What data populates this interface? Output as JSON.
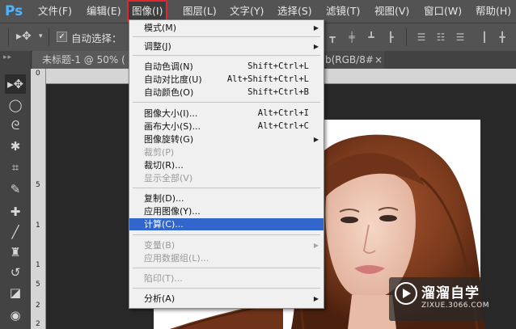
{
  "app": {
    "logo": "Ps"
  },
  "menubar": {
    "items": [
      {
        "label": "文件(F)"
      },
      {
        "label": "编辑(E)"
      },
      {
        "label": "图像(I)"
      },
      {
        "label": "图层(L)"
      },
      {
        "label": "文字(Y)"
      },
      {
        "label": "选择(S)"
      },
      {
        "label": "滤镜(T)"
      },
      {
        "label": "视图(V)"
      },
      {
        "label": "窗口(W)"
      },
      {
        "label": "帮助(H)"
      }
    ],
    "active_item": "图像(I)"
  },
  "options": {
    "auto_select_label": "自动选择：",
    "auto_select_checked": true
  },
  "tabs": {
    "doc1": "未标题-1 @ 50% (",
    "doc2": "b(RGB/8#)",
    "close": "×"
  },
  "ruler": {
    "v_marks": [
      "0",
      "5",
      "1",
      "1",
      "5",
      "2",
      "2"
    ]
  },
  "image_menu": {
    "items": [
      {
        "label": "模式(M)",
        "shortcut": "",
        "submenu": true,
        "disabled": false
      },
      {
        "sep": true
      },
      {
        "label": "调整(J)",
        "shortcut": "",
        "submenu": true,
        "disabled": false
      },
      {
        "sep": true
      },
      {
        "label": "自动色调(N)",
        "shortcut": "Shift+Ctrl+L",
        "submenu": false,
        "disabled": false
      },
      {
        "label": "自动对比度(U)",
        "shortcut": "Alt+Shift+Ctrl+L",
        "submenu": false,
        "disabled": false
      },
      {
        "label": "自动颜色(O)",
        "shortcut": "Shift+Ctrl+B",
        "submenu": false,
        "disabled": false
      },
      {
        "sep": true
      },
      {
        "label": "图像大小(I)...",
        "shortcut": "Alt+Ctrl+I",
        "submenu": false,
        "disabled": false
      },
      {
        "label": "画布大小(S)...",
        "shortcut": "Alt+Ctrl+C",
        "submenu": false,
        "disabled": false
      },
      {
        "label": "图像旋转(G)",
        "shortcut": "",
        "submenu": true,
        "disabled": false
      },
      {
        "label": "裁剪(P)",
        "shortcut": "",
        "submenu": false,
        "disabled": true
      },
      {
        "label": "裁切(R)...",
        "shortcut": "",
        "submenu": false,
        "disabled": false
      },
      {
        "label": "显示全部(V)",
        "shortcut": "",
        "submenu": false,
        "disabled": true
      },
      {
        "sep": true
      },
      {
        "label": "复制(D)...",
        "shortcut": "",
        "submenu": false,
        "disabled": false
      },
      {
        "label": "应用图像(Y)...",
        "shortcut": "",
        "submenu": false,
        "disabled": false
      },
      {
        "label": "计算(C)...",
        "shortcut": "",
        "submenu": false,
        "disabled": false,
        "highlighted": true
      },
      {
        "sep": true
      },
      {
        "label": "变量(B)",
        "shortcut": "",
        "submenu": true,
        "disabled": true
      },
      {
        "label": "应用数据组(L)...",
        "shortcut": "",
        "submenu": false,
        "disabled": true
      },
      {
        "sep": true
      },
      {
        "label": "陷印(T)...",
        "shortcut": "",
        "submenu": false,
        "disabled": true
      },
      {
        "sep": true
      },
      {
        "label": "分析(A)",
        "shortcut": "",
        "submenu": true,
        "disabled": false
      }
    ]
  },
  "watermark": {
    "title": "溜溜自学",
    "url": "ZIXUE.3066.COM"
  },
  "colors": {
    "accent_red": "#e3262d",
    "highlight_blue": "#3366cc",
    "ui_dark": "#535353"
  }
}
